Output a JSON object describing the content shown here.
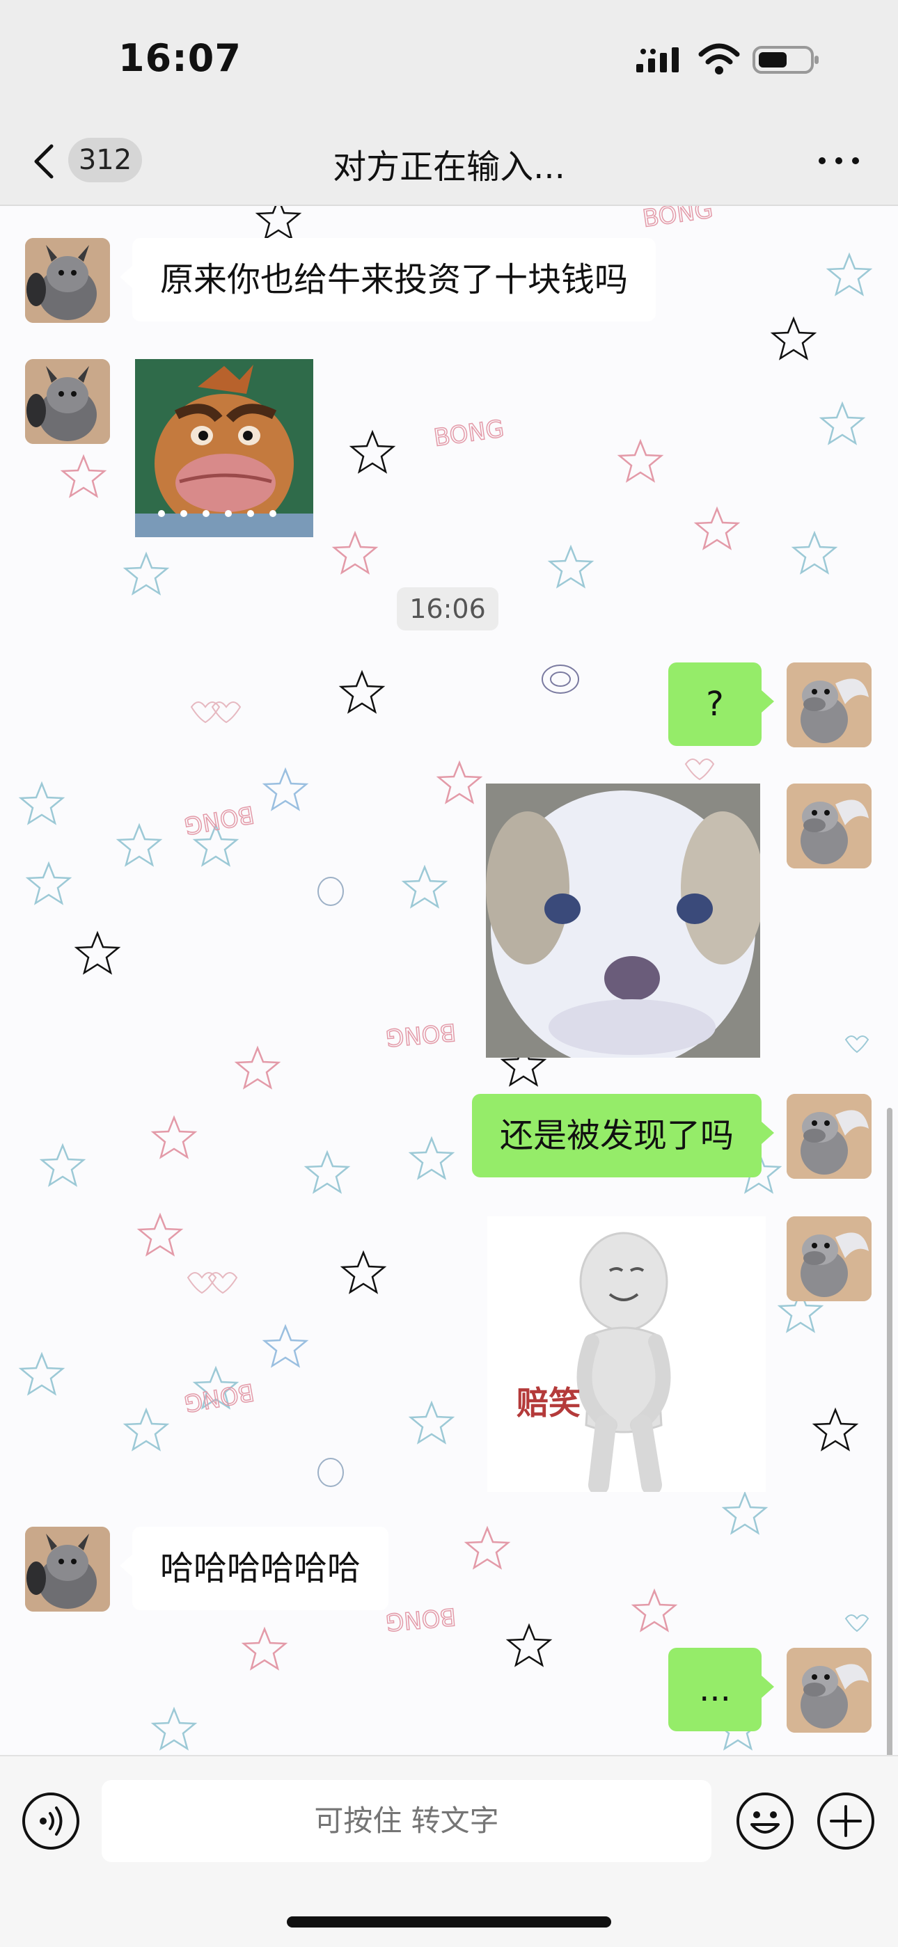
{
  "status_bar": {
    "time": "16:07"
  },
  "nav": {
    "unread_count": "312",
    "title": "对方正在输入..."
  },
  "messages": [
    {
      "side": "left",
      "kind": "text",
      "text": "原来你也给牛来投资了十块钱吗"
    },
    {
      "side": "left",
      "kind": "sticker",
      "sticker": "funny-bird-face-sticker"
    },
    {
      "kind": "timestamp",
      "text": "16:06"
    },
    {
      "side": "right",
      "kind": "text",
      "text": "?"
    },
    {
      "side": "right",
      "kind": "sticker",
      "sticker": "blurry-puppy-sticker"
    },
    {
      "side": "right",
      "kind": "text",
      "text": "还是被发现了吗"
    },
    {
      "side": "right",
      "kind": "sticker",
      "sticker": "white-figure-sticker",
      "caption": "赔笑"
    },
    {
      "side": "left",
      "kind": "text",
      "text": "哈哈哈哈哈哈"
    },
    {
      "side": "right",
      "kind": "text",
      "text": "..."
    }
  ],
  "input_bar": {
    "placeholder": "可按住 转文字"
  },
  "icons": {
    "back": "chevron-left-icon",
    "more": "more-dots-icon",
    "voice": "voice-icon",
    "emoji": "emoji-icon",
    "plus": "plus-icon"
  },
  "colors": {
    "self_bubble": "#95ec69",
    "other_bubble": "#ffffff",
    "bar_background": "#ededed"
  }
}
